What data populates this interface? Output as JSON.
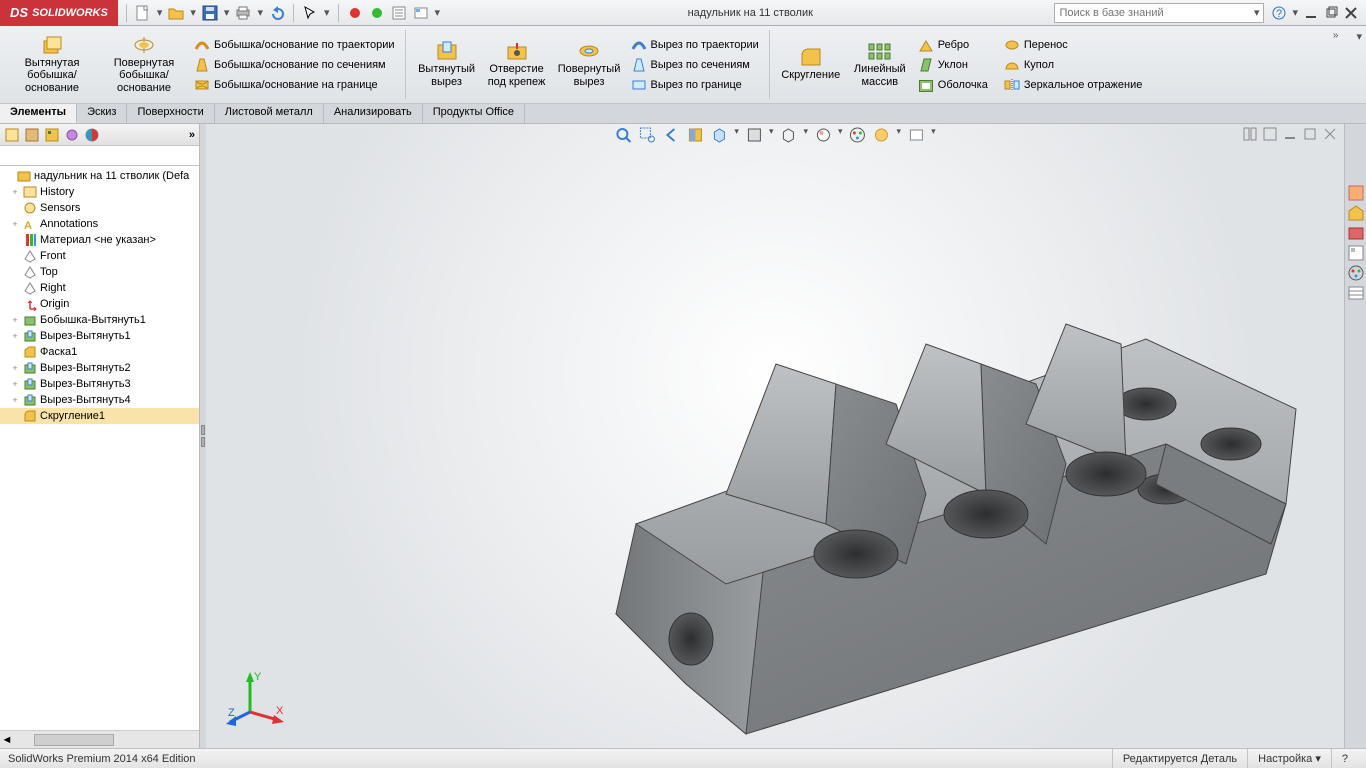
{
  "app": {
    "brand_short": "DS",
    "brand": "SOLIDWORKS",
    "doc_title": "надульник  на 11 стволик",
    "search_placeholder": "Поиск в базе знаний"
  },
  "ribbon": {
    "big": {
      "extrude_boss": "Вытянутая бобышка/основание",
      "revolve_boss": "Повернутая бобышка/основание",
      "extrude_cut": "Вытянутый вырез",
      "hole_wizard": "Отверстие под крепеж",
      "revolve_cut": "Повернутый вырез",
      "fillet": "Скругление",
      "linear_pattern": "Линейный массив"
    },
    "boss_list": {
      "swept": "Бобышка/основание по траектории",
      "lofted": "Бобышка/основание по сечениям",
      "boundary": "Бобышка/основание на границе"
    },
    "cut_list": {
      "swept": "Вырез по траектории",
      "lofted": "Вырез по сечениям",
      "boundary": "Вырез по границе"
    },
    "feat_list": {
      "rib": "Ребро",
      "draft": "Уклон",
      "shell": "Оболочка",
      "wrap": "Перенос",
      "dome": "Купол",
      "mirror": "Зеркальное отражение"
    }
  },
  "tabs": [
    "Элементы",
    "Эскиз",
    "Поверхности",
    "Листовой металл",
    "Анализировать",
    "Продукты Office"
  ],
  "tree": {
    "root": "надульник  на 11 стволик  (Defa",
    "items": [
      "History",
      "Sensors",
      "Annotations",
      "Материал <не указан>",
      "Front",
      "Top",
      "Right",
      "Origin",
      "Бобышка-Вытянуть1",
      "Вырез-Вытянуть1",
      "Фаска1",
      "Вырез-Вытянуть2",
      "Вырез-Вытянуть3",
      "Вырез-Вытянуть4",
      "Скругление1"
    ]
  },
  "status": {
    "left": "SolidWorks Premium 2014 x64 Edition",
    "mode": "Редактируется Деталь",
    "custom": "Настройка"
  },
  "triad": {
    "x": "X",
    "y": "Y",
    "z": "Z"
  }
}
